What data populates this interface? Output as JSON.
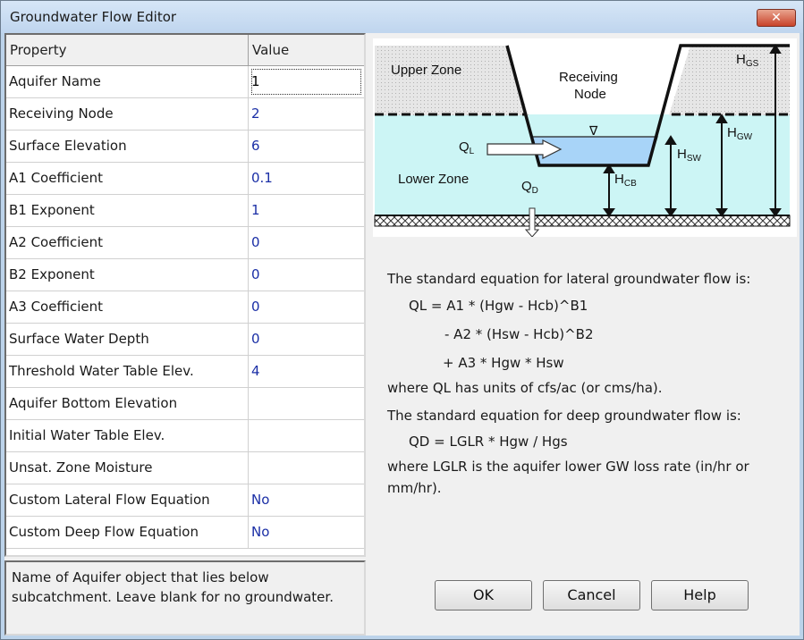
{
  "window": {
    "title": "Groundwater Flow Editor",
    "close_glyph": "✕"
  },
  "grid": {
    "headers": {
      "property": "Property",
      "value": "Value"
    },
    "rows": [
      {
        "property": "Aquifer Name",
        "value": "1"
      },
      {
        "property": "Receiving Node",
        "value": "2"
      },
      {
        "property": "Surface Elevation",
        "value": "6"
      },
      {
        "property": "A1 Coefficient",
        "value": "0.1"
      },
      {
        "property": "B1 Exponent",
        "value": "1"
      },
      {
        "property": "A2 Coefficient",
        "value": "0"
      },
      {
        "property": "B2 Exponent",
        "value": "0"
      },
      {
        "property": "A3 Coefficient",
        "value": "0"
      },
      {
        "property": "Surface Water Depth",
        "value": "0"
      },
      {
        "property": "Threshold Water Table Elev.",
        "value": "4"
      },
      {
        "property": "Aquifer Bottom Elevation",
        "value": ""
      },
      {
        "property": "Initial Water Table Elev.",
        "value": ""
      },
      {
        "property": "Unsat. Zone Moisture",
        "value": ""
      },
      {
        "property": "Custom Lateral Flow Equation",
        "value": "No"
      },
      {
        "property": "Custom Deep Flow Equation",
        "value": "No"
      }
    ]
  },
  "hint": {
    "line1": "Name of Aquifer object that lies below",
    "line2": "subcatchment. Leave blank for no groundwater."
  },
  "diagram": {
    "upper_zone": "Upper Zone",
    "lower_zone": "Lower Zone",
    "receiving_node_1": "Receiving",
    "receiving_node_2": "Node",
    "ql": {
      "main": "Q",
      "sub": "L"
    },
    "qd": {
      "main": "Q",
      "sub": "D"
    },
    "hgs": {
      "main": "H",
      "sub": "GS"
    },
    "hgw": {
      "main": "H",
      "sub": "GW"
    },
    "hsw": {
      "main": "H",
      "sub": "SW"
    },
    "hcb": {
      "main": "H",
      "sub": "CB"
    },
    "water_symbol": "∇"
  },
  "equations": {
    "lateral_intro": "The standard equation for lateral groundwater flow is:",
    "lateral_1": "QL  =  A1 * (Hgw - Hcb)^B1",
    "lateral_2": "- A2 * (Hsw - Hcb)^B2",
    "lateral_3": "+ A3 * Hgw * Hsw",
    "lateral_units": "where QL has units of cfs/ac (or cms/ha).",
    "deep_intro": "The standard equation for deep groundwater flow is:",
    "deep_1": "QD  =  LGLR * Hgw / Hgs",
    "deep_units_1": "where LGLR is the aquifer lower GW loss rate (in/hr or",
    "deep_units_2": "mm/hr)."
  },
  "buttons": {
    "ok": "OK",
    "cancel": "Cancel",
    "help": "Help"
  },
  "colors": {
    "title_bar": "#bfd5ee",
    "close_button": "#c8432a",
    "value_text": "#1b2fa6",
    "water": "#ccf5f5",
    "channel_water": "#a8d4f8",
    "upper_soil": "#e6e6e6"
  }
}
